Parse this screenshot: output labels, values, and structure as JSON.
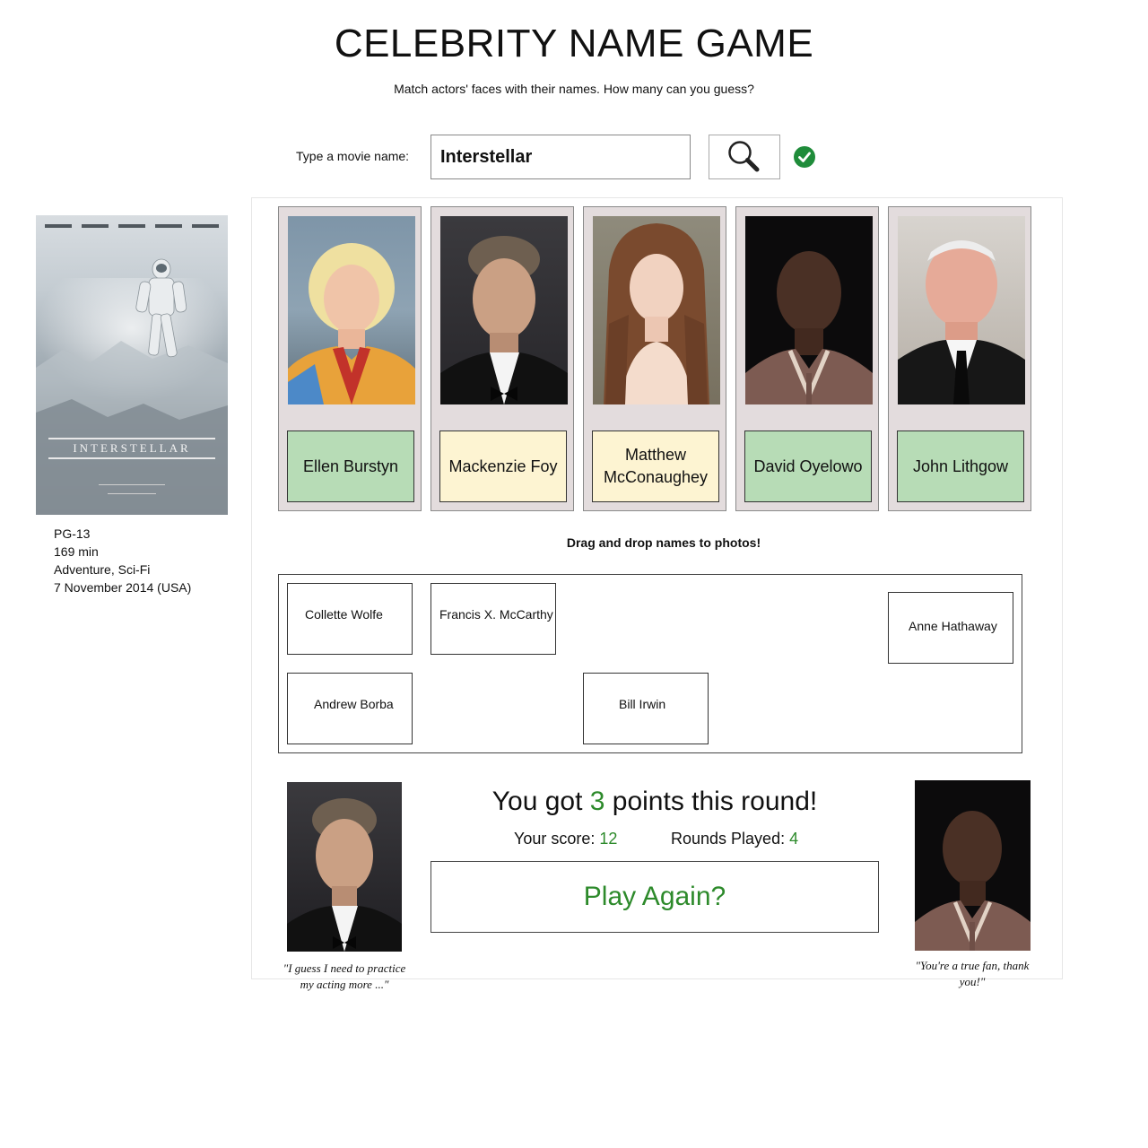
{
  "header": {
    "title": "CELEBRITY NAME GAME",
    "subtitle": "Match actors' faces with their names. How many can you guess?"
  },
  "search": {
    "label": "Type a movie name:",
    "value": "Interstellar",
    "search_icon": "magnifier-icon",
    "status_icon": "check-circle-icon",
    "status_color": "#1f8c3a"
  },
  "movie": {
    "poster_title": "INTERSTELLAR",
    "rating": "PG-13",
    "runtime": "169 min",
    "genres": "Adventure, Sci-Fi",
    "release": "7 November 2014 (USA)"
  },
  "cards": [
    {
      "name": "Ellen Burstyn",
      "state": "correct"
    },
    {
      "name": "Mackenzie Foy",
      "state": "wrong"
    },
    {
      "name": "Matthew McConaughey",
      "state": "wrong"
    },
    {
      "name": "David Oyelowo",
      "state": "correct"
    },
    {
      "name": "John Lithgow",
      "state": "correct"
    }
  ],
  "drag_hint": "Drag and drop names to photos!",
  "name_pool": [
    "Collette Wolfe",
    "Francis X. McCarthy",
    "Anne Hathaway",
    "Andrew Borba",
    "Bill Irwin"
  ],
  "result": {
    "prefix": "You got ",
    "points": "3",
    "suffix": " points this round!",
    "score_label": "Your score: ",
    "score": "12",
    "rounds_label": "Rounds Played: ",
    "rounds": "4",
    "play_again": "Play Again?"
  },
  "quotes": {
    "left": "\"I guess I need to practice my acting more ...\"",
    "right": "\"You're a true fan, thank you!\""
  },
  "colors": {
    "correct": "#b7dcb6",
    "wrong": "#fdf4d2",
    "accent_green": "#2d8a2b",
    "card_bg": "#e3dcdd"
  }
}
